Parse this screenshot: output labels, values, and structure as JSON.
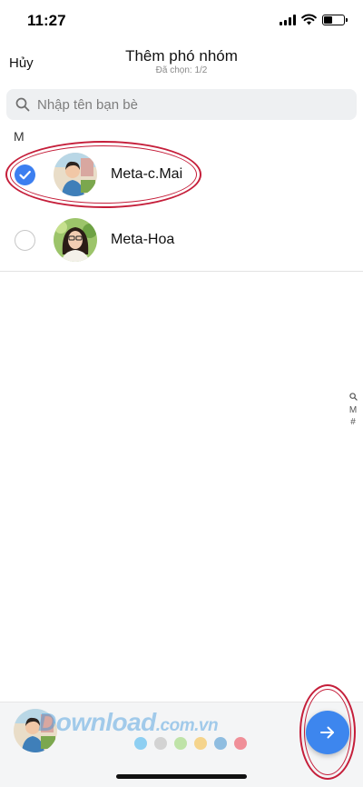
{
  "status_bar": {
    "time": "11:27",
    "battery_level": 0.45
  },
  "header": {
    "cancel_label": "Hủy",
    "title": "Thêm phó nhóm",
    "subtitle": "Đã chọn: 1/2"
  },
  "search": {
    "placeholder": "Nhập tên bạn bè",
    "value": ""
  },
  "section": {
    "letter": "M"
  },
  "contacts": [
    {
      "name": "Meta-c.Mai",
      "selected": true
    },
    {
      "name": "Meta-Hoa",
      "selected": false
    }
  ],
  "index_bar": {
    "items": [
      "M",
      "#"
    ]
  },
  "bottom_bar": {
    "watermark_main": "Download",
    "watermark_domain": ".com.vn",
    "dot_colors": [
      "#8ecff2",
      "#d3d3d3",
      "#bfe3a8",
      "#f5d48c",
      "#8fbde0",
      "#f08f98"
    ]
  },
  "colors": {
    "accent": "#3d86ee",
    "highlight": "#c51e3a"
  }
}
